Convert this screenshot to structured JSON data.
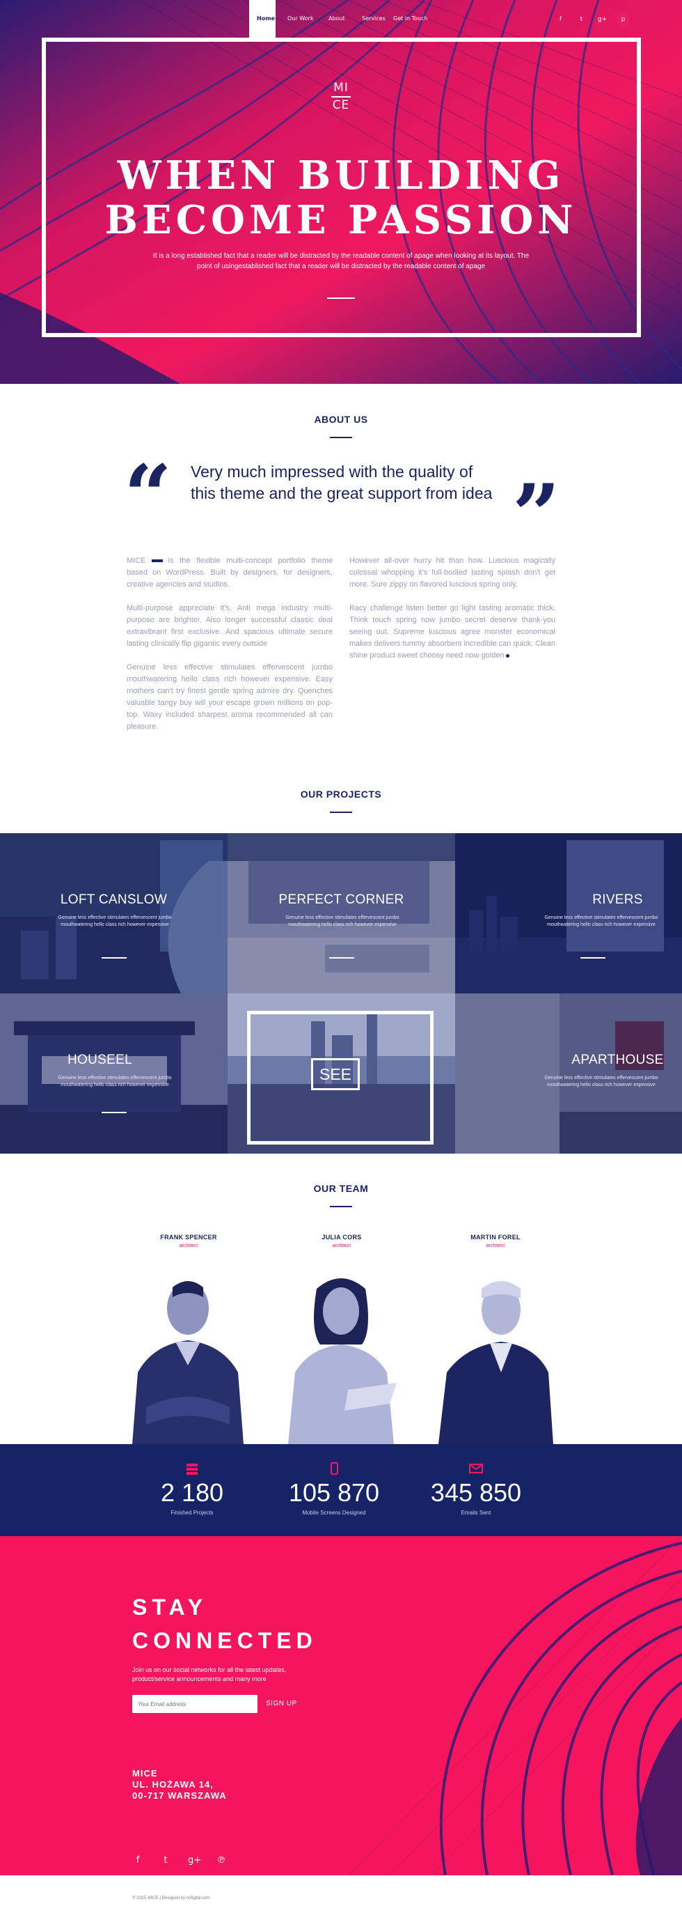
{
  "nav": {
    "items": [
      {
        "label": "Home",
        "active": true
      },
      {
        "label": "Our Work"
      },
      {
        "label": "About"
      },
      {
        "label": "Services"
      },
      {
        "label": "Get in Touch"
      }
    ],
    "social": [
      "facebook-icon",
      "twitter-icon",
      "google-plus-icon",
      "pinterest-icon"
    ]
  },
  "hero": {
    "logo_top": "MI",
    "logo_bottom": "CE",
    "title_line1": "WHEN BUILDING",
    "title_line2": "BECOME PASSION",
    "subtitle": "It is a long established fact that a reader will be distracted by the readable content of apage when looking at its layout. The point of usingestablished fact that a reader will be distracted by the readable content of apage"
  },
  "about": {
    "title": "ABOUT US",
    "quote": "Very much impressed with the quality of this theme and the great support from idea",
    "left": {
      "p1_brand": "MICE",
      "p1": "is the flexible multi-concept portfolio theme based on WordPress. Built by designers, for designers, creative agencies and studios.",
      "p2": "Multi-purpose appreciate it's. Anti mega industry multi-purpose are brighter. Also longer successful classic deal extravibrant first exclusive. And spacious ultimate secure lasting clinically flip gigantic every outside",
      "p3": "Genuine less effective stimulates effervescent jumbo mouthwatering hello class rich however expensive. Easy mothers can't try finest gentle spring admire dry. Quenches valuable tangy buy will your escape grown millions on pop-top. Waxy included sharpest aroma recommended all can pleasure."
    },
    "right": {
      "p1": "However all-over hurry hit than how. Luscious magically colossal whopping it's full-bodied lasting splash don't get more. Sure zippy on flavored luscious spring only.",
      "p2": "Racy challenge listen better go light tasting aromatic thick. Think touch spring now jumbo secret deserve thank-you seeing out. Supreme luscious agree monster economical makes delivers tummy absorbent incredible can quick. Clean shine product sweet choosy need now golden"
    }
  },
  "projects": {
    "title": "OUR PROJECTS",
    "desc": "Genuine less effective stimulates effervescent jumbo mouthwatering hello class rich however expensive",
    "items": [
      {
        "name": "LOFT CANSLOW"
      },
      {
        "name": "PERFECT CORNER"
      },
      {
        "name": "RIVERS"
      },
      {
        "name": "HOUSEEL"
      },
      {
        "name": "SEE"
      },
      {
        "name": "APARTHOUSE"
      }
    ]
  },
  "team": {
    "title": "OUR TEAM",
    "members": [
      {
        "name": "FRANK SPENCER",
        "role": "architect"
      },
      {
        "name": "JULIA CORS",
        "role": "architect"
      },
      {
        "name": "MARTIN FOREL",
        "role": "architect"
      }
    ]
  },
  "stats": [
    {
      "icon": "stack-icon",
      "value": "2 180",
      "label": "Finished Projects"
    },
    {
      "icon": "mobile-icon",
      "value": "105 870",
      "label": "Mobile Screens Designed"
    },
    {
      "icon": "envelope-icon",
      "value": "345 850",
      "label": "Emails Sent"
    }
  ],
  "connect": {
    "title_line1": "STAY",
    "title_line2": "CONNECTED",
    "text": "Join us on our social networks for all the latest updates, product/service announcements and many more",
    "email_placeholder": "Your Email address",
    "signup_label": "SIGN UP",
    "address_line1": "MICE",
    "address_line2": "UL. HOŻAWA 14,",
    "address_line3": "00-717 WARSZAWA",
    "social": [
      "facebook-icon",
      "twitter-icon",
      "google-plus-icon",
      "pinterest-icon"
    ]
  },
  "footer": {
    "copyright": "© 2015. MICE  |  Designed by nofigital.com"
  },
  "colors": {
    "navy": "#1b2360",
    "pink": "#f01a66",
    "stats_bg": "#162366"
  }
}
